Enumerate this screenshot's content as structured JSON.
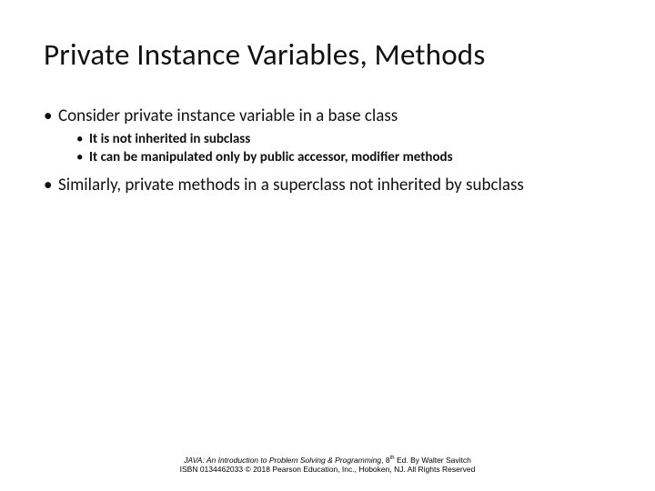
{
  "title": "Private Instance Variables, Methods",
  "bullets": {
    "b1": "Consider private instance variable in a base class",
    "b1a": "It is not inherited in subclass",
    "b1b": "It can be manipulated only by public accessor, modifier methods",
    "b2": "Similarly, private methods in a superclass not inherited by subclass"
  },
  "footer": {
    "book_title": "JAVA: An Introduction to Problem Solving & Programming",
    "edition_num": "8",
    "edition_suffix": "th",
    "edition_tail": " Ed. By Walter Savitch",
    "line2": "ISBN 0134462033 © 2018 Pearson Education, Inc., Hoboken, NJ. All Rights Reserved"
  }
}
